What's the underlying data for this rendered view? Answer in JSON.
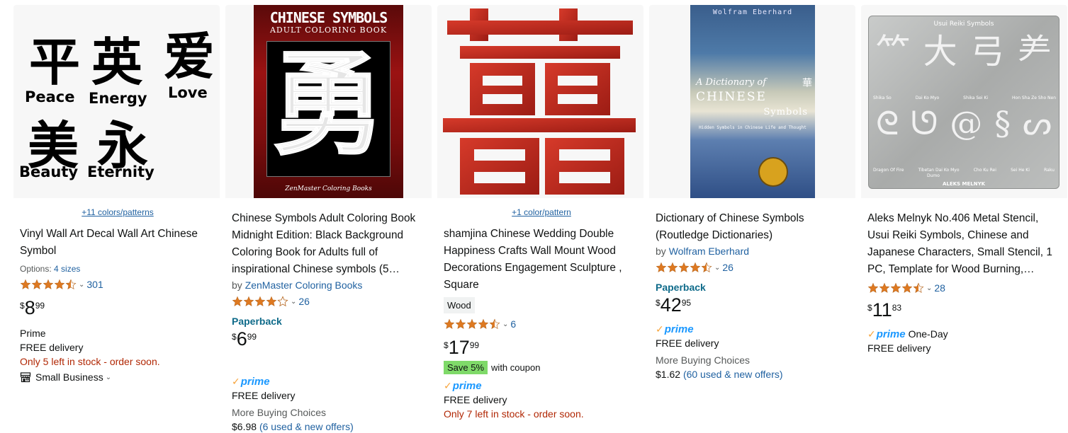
{
  "products": [
    {
      "swatch_link": "+11 colors/patterns",
      "title": "Vinyl Wall Art Decal Wall Art Chinese Symbol",
      "options_label": "Options:",
      "options_link": "4 sizes",
      "rating": 4.5,
      "rating_count": "301",
      "price_symbol": "$",
      "price_whole": "8",
      "price_fraction": "99",
      "prime_text": "Prime",
      "delivery": "FREE delivery",
      "stock": "Only 5 left in stock - order soon.",
      "small_business": "Small Business",
      "image_text": {
        "c1": "平",
        "c2": "英",
        "c3": "爱",
        "c4": "美",
        "c5": "永",
        "w1": "Peace",
        "w2": "Energy",
        "w3": "Love",
        "w4": "Beauty",
        "w5": "Eternity"
      }
    },
    {
      "title": "Chinese Symbols Adult Coloring Book Midnight Edition: Black Background Coloring Book for Adults full of inspirational Chinese symbols (5…",
      "byline_prefix": "by",
      "author": "ZenMaster Coloring Books",
      "rating": 4.0,
      "rating_count": "26",
      "format": "Paperback",
      "price_symbol": "$",
      "price_whole": "6",
      "price_fraction": "99",
      "delivery": "FREE delivery",
      "more_choices": "More Buying Choices",
      "offer_price": "$6.98",
      "offer_link": "(6 used & new offers)",
      "image_text": {
        "title": "CHINESE SYMBOLS",
        "subtitle": "ADULT COLORING BOOK",
        "glyph": "勇",
        "publisher": "ZenMaster Coloring Books"
      }
    },
    {
      "swatch_link": "+1 color/pattern",
      "title": "shamjina Chinese Wedding Double Happiness Crafts Wall Mount Wood Decorations Engagement Sculpture , Square",
      "badge": "Wood",
      "rating": 4.5,
      "rating_count": "6",
      "price_symbol": "$",
      "price_whole": "17",
      "price_fraction": "99",
      "coupon_tag": "Save 5%",
      "coupon_text": "with coupon",
      "delivery": "FREE delivery",
      "stock": "Only 7 left in stock - order soon."
    },
    {
      "title": "Dictionary of Chinese Symbols (Routledge Dictionaries)",
      "byline_prefix": "by",
      "author": "Wolfram Eberhard",
      "rating": 4.5,
      "rating_count": "26",
      "format": "Paperback",
      "price_symbol": "$",
      "price_whole": "42",
      "price_fraction": "95",
      "delivery": "FREE delivery",
      "more_choices": "More Buying Choices",
      "offer_price": "$1.62",
      "offer_link": "(60 used & new offers)",
      "image_text": {
        "author": "Wolfram Eberhard",
        "line1": "A Dictionary of",
        "line2": "CHINESE",
        "line3": "Symbols",
        "line4": "Hidden Symbols in Chinese Life and Thought",
        "seal": "華"
      }
    },
    {
      "title": "Aleks Melnyk No.406 Metal Stencil, Usui Reiki Symbols, Chinese and Japanese Characters, Small Stencil, 1 PC, Template for Wood Burning,…",
      "rating": 4.5,
      "rating_count": "28",
      "price_symbol": "$",
      "price_whole": "11",
      "price_fraction": "83",
      "prime_extra": "One-Day",
      "delivery": "FREE delivery",
      "image_text": {
        "header": "Usui Reiki Symbols",
        "labels": [
          "Shika So",
          "Dai Ko Myo",
          "Shika Sei Ki",
          "Hon Sha Ze Sho Nen"
        ],
        "labels2": [
          "Dragon Of Fire",
          "Tibetan Dai Ko Myo",
          "Cho Ku Rei",
          "Sei He Ki",
          "Raku"
        ],
        "extra": "Dumo",
        "footer": "ALEKS MELNYK"
      }
    }
  ],
  "colors": {
    "link": "#2162a1",
    "price_red": "#b12704",
    "star": "#de7921",
    "prime": "#1a98ff",
    "coupon": "#7fda69",
    "paperback": "#0f6b8a"
  }
}
